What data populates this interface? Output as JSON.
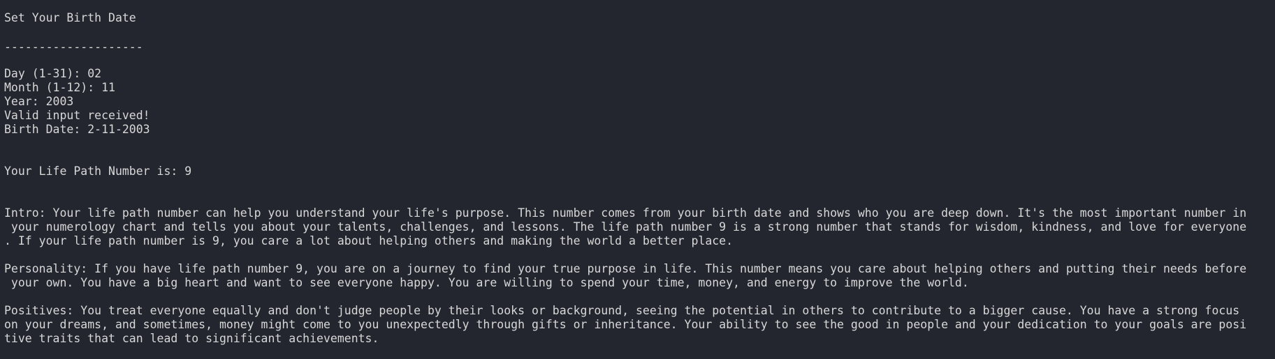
{
  "terminal": {
    "heading": "Set Your Birth Date",
    "separator": "--------------------",
    "day_line": "Day (1-31): 02",
    "month_line": "Month (1-12): 11",
    "year_line": "Year: 2003",
    "valid_line": "Valid input received!",
    "birth_date_line": "Birth Date: 2-11-2003",
    "life_path_line": "Your Life Path Number is: 9",
    "intro": [
      "Intro: Your life path number can help you understand your life's purpose. This number comes from your birth date and shows who you are deep down. It's the most important number in",
      " your numerology chart and tells you about your talents, challenges, and lessons. The life path number 9 is a strong number that stands for wisdom, kindness, and love for everyone",
      ". If your life path number is 9, you care a lot about helping others and making the world a better place."
    ],
    "personality": [
      "Personality: If you have life path number 9, you are on a journey to find your true purpose in life. This number means you care about helping others and putting their needs before",
      " your own. You have a big heart and want to see everyone happy. You are willing to spend your time, money, and energy to improve the world."
    ],
    "positives": [
      "Positives: You treat everyone equally and don't judge people by their looks or background, seeing the potential in others to contribute to a bigger cause. You have a strong focus",
      "on your dreams, and sometimes, money might come to you unexpectedly through gifts or inheritance. Your ability to see the good in people and your dedication to your goals are posi",
      "tive traits that can lead to significant achievements."
    ]
  }
}
